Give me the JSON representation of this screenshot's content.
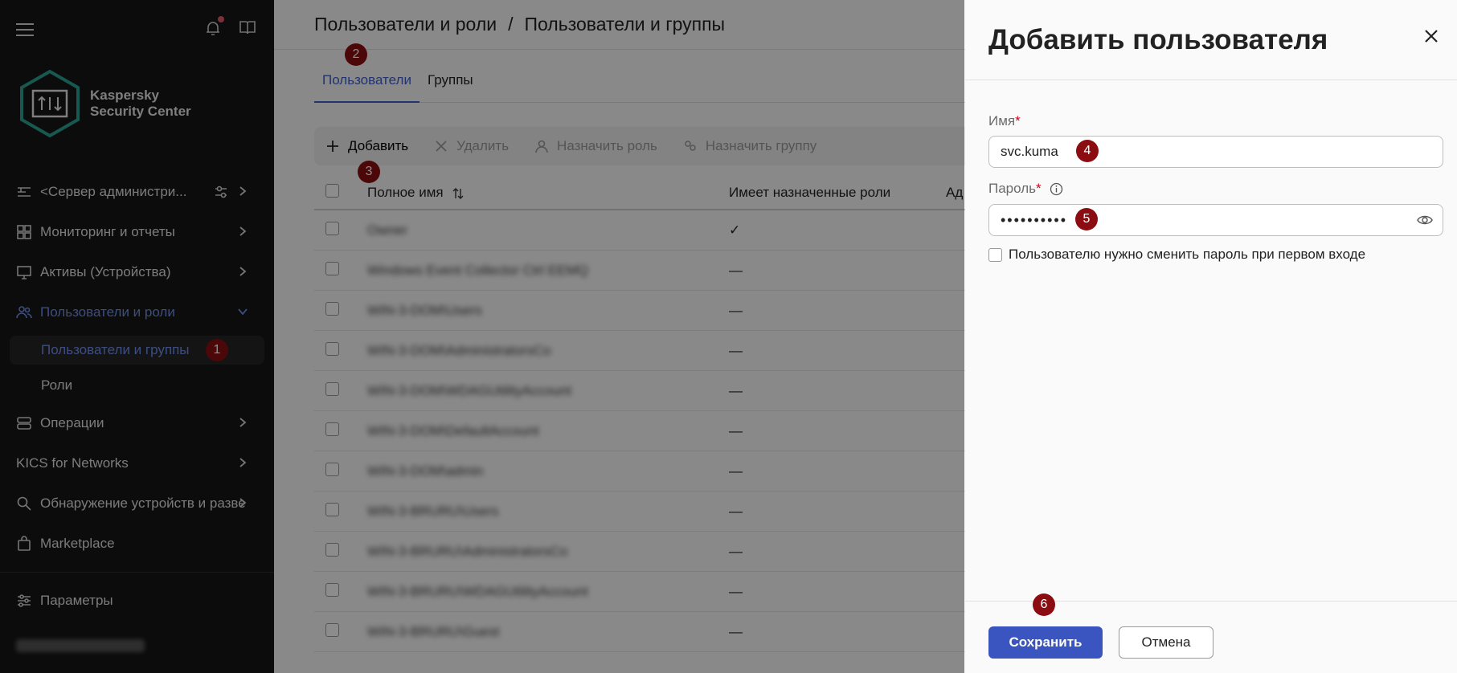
{
  "sidebar": {
    "product_name": "Kaspersky Security Center",
    "items": [
      {
        "label": "<Сервер администри..."
      },
      {
        "label": "Мониторинг и отчеты"
      },
      {
        "label": "Активы (Устройства)"
      },
      {
        "label": "Пользователи и роли"
      },
      {
        "label": "Пользователи и группы"
      },
      {
        "label": "Роли"
      },
      {
        "label": "Операции"
      },
      {
        "label": "KICS for Networks"
      },
      {
        "label": "Обнаружение устройств и разве"
      },
      {
        "label": "Marketplace"
      },
      {
        "label": "Параметры"
      }
    ]
  },
  "badges": {
    "b1": "1",
    "b2": "2",
    "b3": "3",
    "b4": "4",
    "b5": "5",
    "b6": "6"
  },
  "header": {
    "section": "Пользователи и роли",
    "separator": "/",
    "page": "Пользователи и группы"
  },
  "tabs": [
    {
      "label": "Пользователи"
    },
    {
      "label": "Группы"
    }
  ],
  "toolbar": {
    "add": "Добавить",
    "delete": "Удалить",
    "assign_role": "Назначить роль",
    "assign_group": "Назначить группу"
  },
  "table": {
    "columns": [
      "Полное имя",
      "Имеет назначенные роли",
      "Ад"
    ],
    "rows": [
      {
        "name": "Owner",
        "roles": "✓"
      },
      {
        "name": "Windows Event Collector Ctrl EEMQ",
        "roles": "—"
      },
      {
        "name": "WIN-3-DOM\\Users",
        "roles": "—"
      },
      {
        "name": "WIN-3-DOM\\AdministratorsCo",
        "roles": "—"
      },
      {
        "name": "WIN-3-DOM\\WDAGUtilityAccount",
        "roles": "—"
      },
      {
        "name": "WIN-3-DOM\\DefaultAccount",
        "roles": "—"
      },
      {
        "name": "WIN-3-DOM\\admin",
        "roles": "—"
      },
      {
        "name": "WIN-3-BRURU\\Users",
        "roles": "—"
      },
      {
        "name": "WIN-3-BRURU\\AdministratorsCo",
        "roles": "—"
      },
      {
        "name": "WIN-3-BRURU\\WDAGUtilityAccount",
        "roles": "—"
      },
      {
        "name": "WIN-3-BRURU\\Guest",
        "roles": "—"
      }
    ]
  },
  "dialog": {
    "title": "Добавить пользователя",
    "name_label": "Имя",
    "required_mark": "*",
    "name_value": "svc.kuma",
    "password_label": "Пароль",
    "password_value": "••••••••••",
    "change_password_label": "Пользователю нужно сменить пароль при первом входе",
    "save": "Сохранить",
    "cancel": "Отмена"
  },
  "colors": {
    "accent": "#3a55bf",
    "badge": "#8b0d12",
    "sidebar_active": "#6f8dea"
  }
}
